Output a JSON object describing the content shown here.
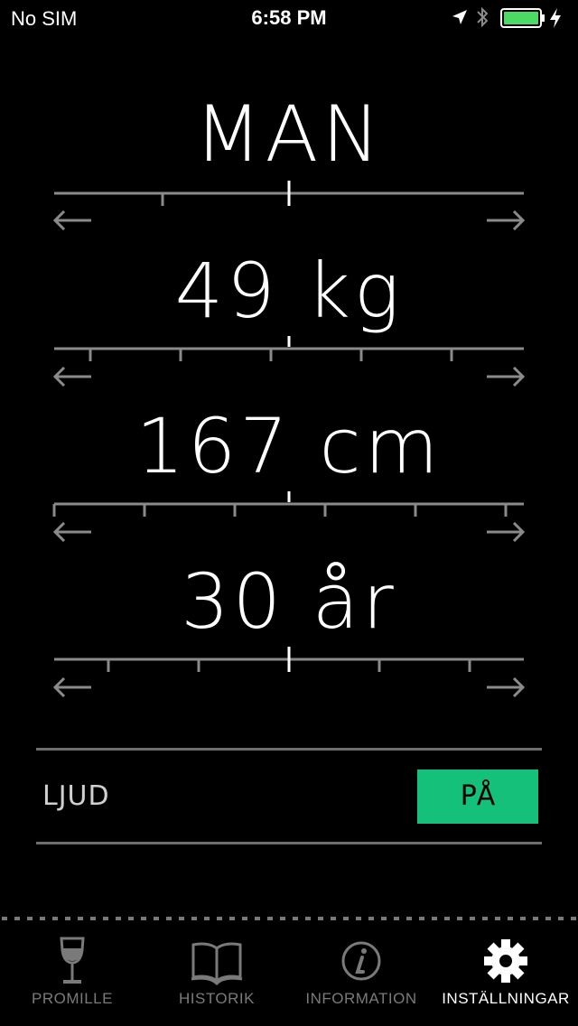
{
  "status_bar": {
    "carrier": "No SIM",
    "time": "6:58 PM",
    "battery_color": "#4cd964"
  },
  "pickers": [
    {
      "id": "gender",
      "value": "MAN"
    },
    {
      "id": "weight",
      "value": "49 kg"
    },
    {
      "id": "height",
      "value": "167 cm"
    },
    {
      "id": "age",
      "value": "30 år"
    }
  ],
  "sound": {
    "label": "LJUD",
    "toggle_label": "PÅ",
    "toggle_color": "#14c07a"
  },
  "tabs": [
    {
      "label": "PROMILLE",
      "icon": "wine-glass-icon",
      "active": false
    },
    {
      "label": "HISTORIK",
      "icon": "book-icon",
      "active": false
    },
    {
      "label": "INFORMATION",
      "icon": "info-icon",
      "active": false
    },
    {
      "label": "INSTÄLLNINGAR",
      "icon": "gear-icon",
      "active": true
    }
  ]
}
